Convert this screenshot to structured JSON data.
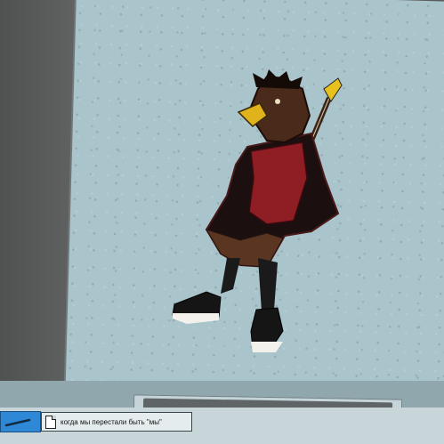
{
  "window": {
    "canvas_color": "#a9c4cb",
    "panel_color": "#5b5c5c"
  },
  "artwork": {
    "icon": "crow-guitarist-illustration"
  },
  "taskbar": {
    "items": [
      {
        "label": "когда мы перестали быть \"мы\"",
        "icon": "file-icon"
      }
    ],
    "start_color": "#2f88d6"
  }
}
